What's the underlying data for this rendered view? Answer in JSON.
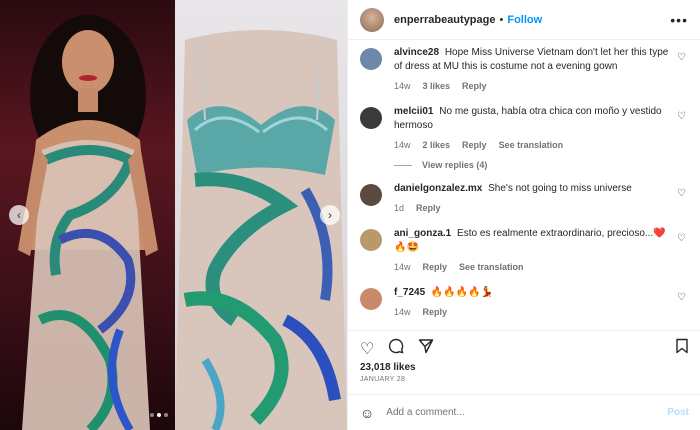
{
  "post": {
    "username": "enperrabeautypage",
    "separator": "•",
    "follow_label": "Follow",
    "more_icon": "more-options-icon",
    "likes": "23,018 likes",
    "date": "JANUARY 28",
    "comment_placeholder": "Add a comment...",
    "post_label": "Post"
  },
  "media": {
    "prev_glyph": "‹",
    "next_glyph": "›"
  },
  "comments": [
    {
      "username": "alvince28",
      "text": "Hope Miss Universe Vietnam don't let her this type of dress at MU this is costume not a evening gown",
      "age": "14w",
      "likes": "3 likes",
      "reply": "Reply",
      "translate": "",
      "avatar_color": "#6c8aa8"
    },
    {
      "username": "melcii01",
      "text": "No me gusta, había otra chica con moño y vestido hermoso",
      "age": "14w",
      "likes": "2 likes",
      "reply": "Reply",
      "translate": "See translation",
      "avatar_color": "#3a3a3a"
    },
    {
      "username": "danielgonzalez.mx",
      "text": "She's not going to miss universe",
      "age": "1d",
      "likes": "",
      "reply": "Reply",
      "translate": "",
      "avatar_color": "#5b4a3f"
    },
    {
      "username": "ani_gonza.1",
      "text": "Esto es realmente extraordinario, precioso...❤️🔥🤩",
      "age": "14w",
      "likes": "",
      "reply": "Reply",
      "translate": "See translation",
      "avatar_color": "#b89a6a"
    },
    {
      "username": "f_7245",
      "text": "🔥🔥🔥🔥💃",
      "age": "14w",
      "likes": "",
      "reply": "Reply",
      "translate": "",
      "avatar_color": "#c98a6a"
    }
  ],
  "view_replies": "View replies (4)",
  "icons": {
    "heart": "heart-icon",
    "comment": "comment-icon",
    "share": "share-icon",
    "bookmark": "bookmark-icon",
    "emoji": "emoji-icon"
  },
  "colors": {
    "accent": "#0095f6",
    "post_disabled": "#b2dffc",
    "muted": "#737373"
  }
}
